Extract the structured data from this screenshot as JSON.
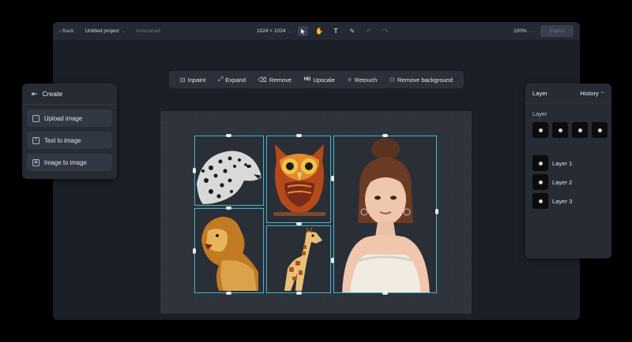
{
  "topbar": {
    "back_label": "Back",
    "project_name": "Untitled project",
    "save_status": "Autosaved",
    "canvas_size": "1024 × 1024",
    "zoom": "100%",
    "export_label": "Export",
    "tools": [
      "select-pointer-icon",
      "hand-icon",
      "text-icon",
      "brush-icon"
    ],
    "undo_icon": "undo-icon",
    "redo_icon": "redo-icon"
  },
  "edit_toolbar": {
    "inpaint": "Inpaint",
    "expand": "Expand",
    "remove": "Remove",
    "upscale_badge": "HD",
    "upscale": "Upscale",
    "retouch": "Retouch",
    "remove_background": "Remove background"
  },
  "create_panel": {
    "title": "Create",
    "items": [
      "Upload image",
      "Text to image",
      "Image to image"
    ]
  },
  "layer_panel": {
    "title": "Layer",
    "history_label": "History",
    "section_label": "Layer",
    "layers": [
      "Layer 1",
      "Layer 2",
      "Layer 3"
    ]
  },
  "canvas": {
    "images": [
      "leopard",
      "owl",
      "lion",
      "giraffe",
      "girl-portrait"
    ]
  },
  "colors": {
    "selection": "#3fb6cf",
    "panel": "#262b34",
    "app_bg": "#1b1f27"
  }
}
